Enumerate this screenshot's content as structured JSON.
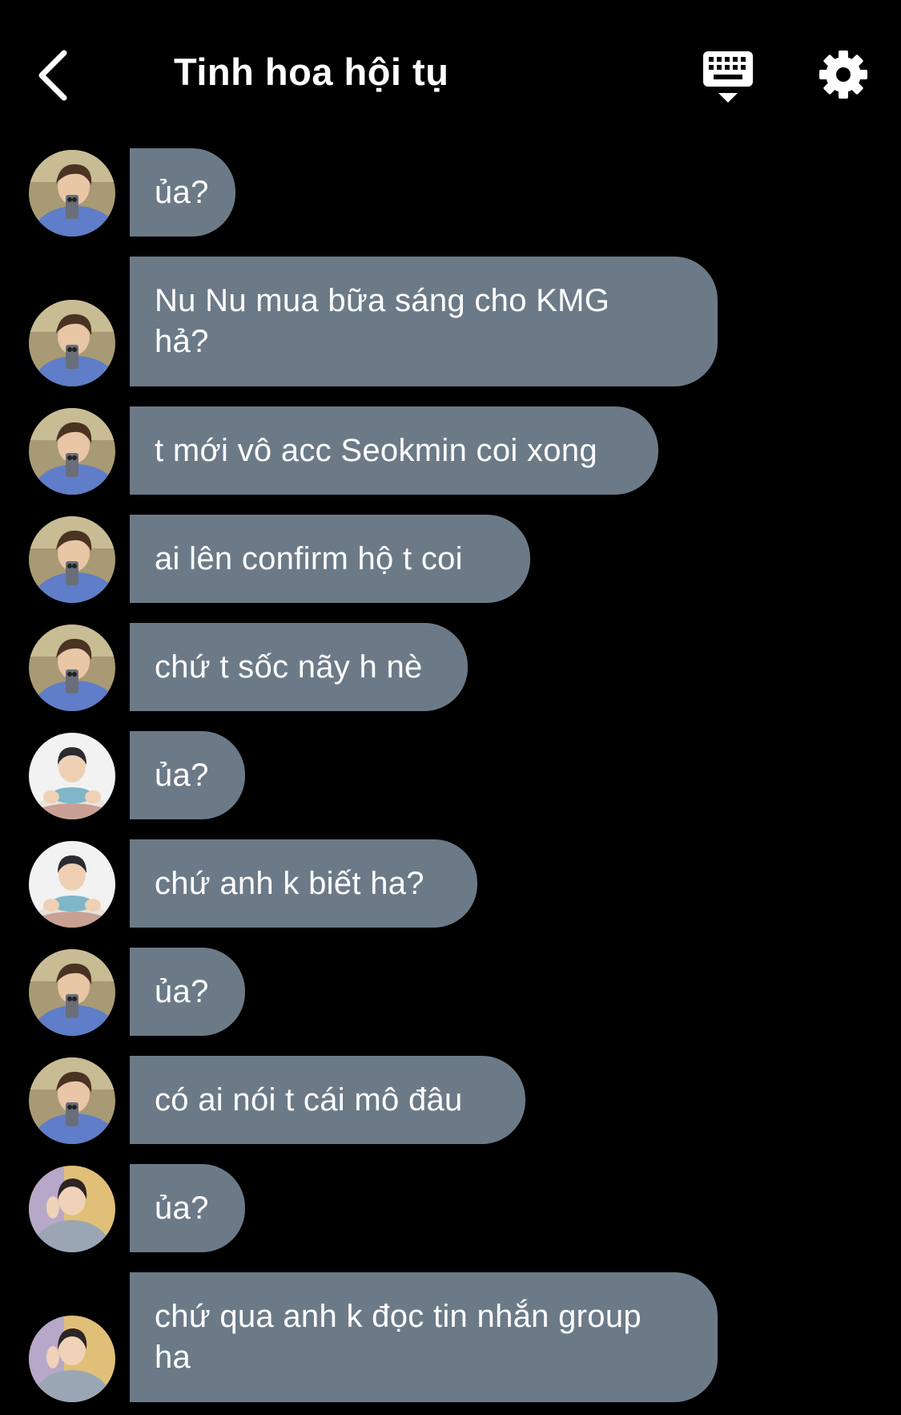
{
  "header": {
    "title": "Tinh hoa hội tụ",
    "back_icon": "chevron-left-icon",
    "keyboard_icon": "keyboard-icon",
    "settings_icon": "gear-icon"
  },
  "colors": {
    "background": "#000000",
    "bubble": "#6c7a88",
    "text": "#ffffff"
  },
  "messages": [
    {
      "sender": "user-a",
      "lines": [
        "ủa?"
      ]
    },
    {
      "sender": "user-a",
      "lines": [
        "Nu Nu mua bữa sáng cho KMG",
        "hả?"
      ]
    },
    {
      "sender": "user-a",
      "lines": [
        "t mới vô acc Seokmin coi xong"
      ]
    },
    {
      "sender": "user-a",
      "lines": [
        "ai lên confirm hộ t coi"
      ]
    },
    {
      "sender": "user-a",
      "lines": [
        "chứ t sốc nãy h nè"
      ]
    },
    {
      "sender": "user-b",
      "lines": [
        "ủa?"
      ]
    },
    {
      "sender": "user-b",
      "lines": [
        "chứ anh k biết ha?"
      ]
    },
    {
      "sender": "user-a",
      "lines": [
        "ủa?"
      ]
    },
    {
      "sender": "user-a",
      "lines": [
        "có ai nói t cái mô đâu"
      ]
    },
    {
      "sender": "user-c",
      "lines": [
        "ủa?"
      ]
    },
    {
      "sender": "user-c",
      "lines": [
        "chứ qua anh k đọc tin nhắn group",
        "ha"
      ]
    }
  ]
}
